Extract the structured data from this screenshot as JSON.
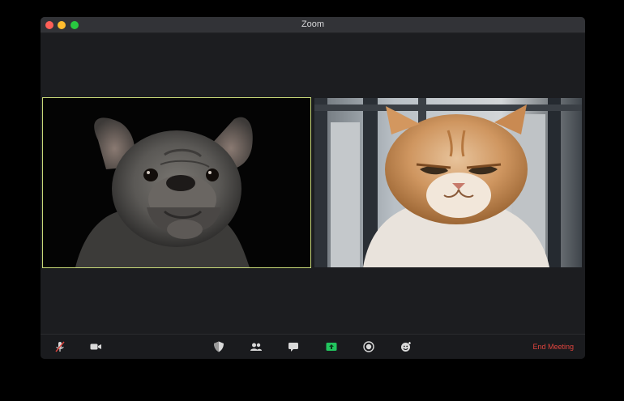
{
  "window": {
    "title": "Zoom"
  },
  "participants": [
    {
      "animal": "dog",
      "active_speaker": true
    },
    {
      "animal": "cat",
      "active_speaker": false
    }
  ],
  "toolbar": {
    "buttons": [
      {
        "icon": "mute-microphone-icon"
      },
      {
        "icon": "video-camera-icon"
      },
      {
        "icon": "security-shield-icon"
      },
      {
        "icon": "participants-icon"
      },
      {
        "icon": "chat-icon"
      },
      {
        "icon": "share-screen-icon"
      },
      {
        "icon": "record-icon"
      },
      {
        "icon": "reactions-icon"
      }
    ],
    "end_meeting_label": "End Meeting"
  },
  "colors": {
    "active_speaker_border": "#c8d978",
    "share_screen_green": "#22c55e",
    "end_meeting_red": "#e0443e",
    "titlebar": "#323337",
    "stage": "#1c1d20"
  }
}
